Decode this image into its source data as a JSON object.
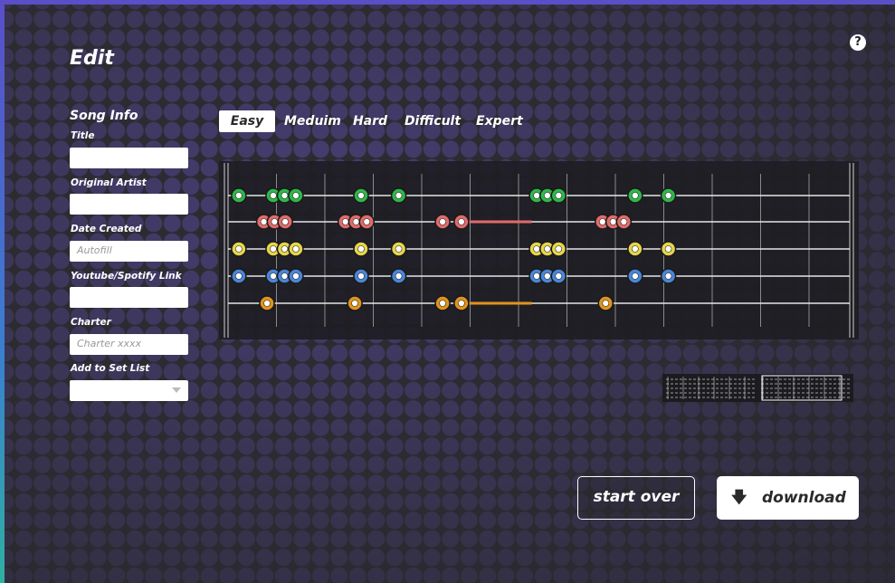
{
  "page": {
    "title": "Edit",
    "help_label": "?"
  },
  "song_info": {
    "section_title": "Song Info",
    "fields": {
      "title": {
        "label": "Title",
        "value": "",
        "placeholder": ""
      },
      "original_artist": {
        "label": "Original Artist",
        "value": "",
        "placeholder": ""
      },
      "date_created": {
        "label": "Date Created",
        "value": "",
        "placeholder": "Autofill"
      },
      "link": {
        "label": "Youtube/Spotify Link",
        "value": "",
        "placeholder": ""
      },
      "charter": {
        "label": "Charter",
        "value": "",
        "placeholder": "Charter xxxx"
      },
      "set_list": {
        "label": "Add to Set List",
        "value": ""
      }
    }
  },
  "difficulty_tabs": {
    "selected": "Easy",
    "items": [
      "Easy",
      "Meduim",
      "Hard",
      "Difficult",
      "Expert"
    ]
  },
  "chart_colors": {
    "lane_green": "#2fb84a",
    "lane_red": "#e06b6b",
    "lane_yellow": "#e6d64a",
    "lane_blue": "#4a86d8",
    "lane_orange": "#e0941e",
    "grid": "#cfcfcf"
  },
  "notes": {
    "lanes": [
      "green",
      "red",
      "yellow",
      "blue",
      "orange"
    ],
    "green": [
      0.02,
      0.075,
      0.093,
      0.111,
      0.215,
      0.275,
      0.495,
      0.512,
      0.53,
      0.652,
      0.705
    ],
    "red": [
      0.06,
      0.077,
      0.094,
      0.19,
      0.207,
      0.224,
      0.345,
      0.375,
      0.6,
      0.617,
      0.634
    ],
    "yellow": [
      0.02,
      0.075,
      0.093,
      0.111,
      0.215,
      0.275,
      0.495,
      0.512,
      0.53,
      0.652,
      0.705
    ],
    "blue": [
      0.02,
      0.075,
      0.093,
      0.111,
      0.215,
      0.275,
      0.495,
      0.512,
      0.53,
      0.652,
      0.705
    ],
    "orange": [
      0.065,
      0.205,
      0.345,
      0.375,
      0.605
    ],
    "sustains": [
      {
        "lane": "red",
        "start": 0.375,
        "end": 0.487
      },
      {
        "lane": "orange",
        "start": 0.375,
        "end": 0.487
      }
    ]
  },
  "actions": {
    "start_over": "start over",
    "download": "download",
    "download_icon": "download-arrow-icon"
  }
}
